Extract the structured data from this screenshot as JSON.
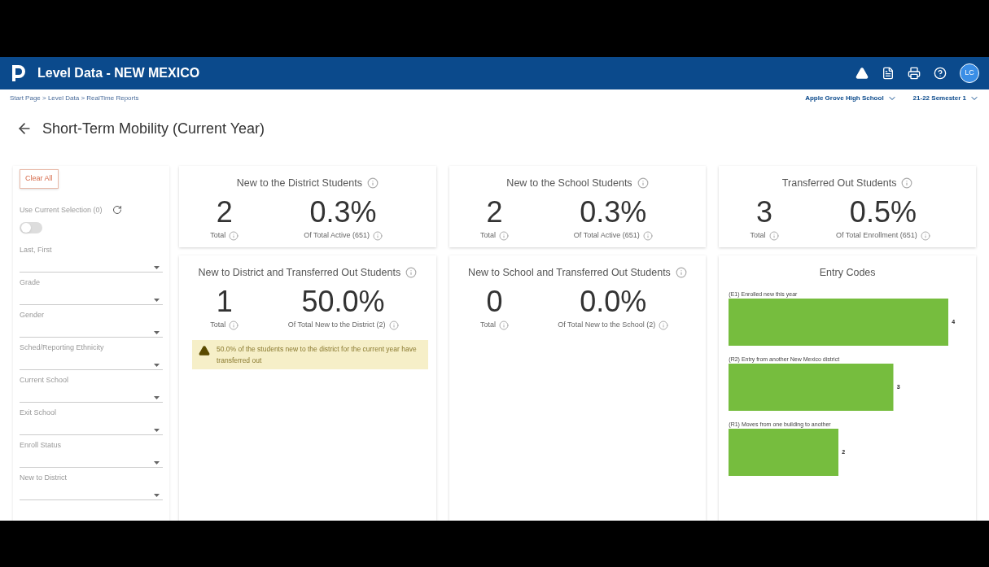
{
  "header": {
    "title": "Level Data - NEW MEXICO",
    "avatar": "LC"
  },
  "breadcrumb": "Start Page > Level Data > RealTime Reports",
  "school_selector": "Apple Grove High School",
  "term_selector": "21-22 Semester 1",
  "page_title": "Short-Term Mobility (Current Year)",
  "filters": {
    "clear_button": "Clear All",
    "use_current_selection": {
      "label": "Use Current Selection (0)",
      "on": false
    },
    "dropdowns": [
      "Last, First",
      "Grade",
      "Gender",
      "Sched/Reporting Ethnicity",
      "Current School",
      "Exit School",
      "Enroll Status",
      "New to District"
    ]
  },
  "cards": [
    {
      "title": "New to the District Students",
      "total": "2",
      "total_label": "Total",
      "percent": "0.3%",
      "percent_label": "Of Total Active (651)"
    },
    {
      "title": "New to the School Students",
      "total": "2",
      "total_label": "Total",
      "percent": "0.3%",
      "percent_label": "Of Total Active (651)"
    },
    {
      "title": "Transferred Out Students",
      "total": "3",
      "total_label": "Total",
      "percent": "0.5%",
      "percent_label": "Of Total Enrollment (651)"
    },
    {
      "title": "New to District and Transferred Out Students",
      "total": "1",
      "total_label": "Total",
      "percent": "50.0%",
      "percent_label": "Of Total New to the District (2)",
      "warning": "50.0% of the students new to the district for the current year have transferred out"
    },
    {
      "title": "New to School and Transferred Out Students",
      "total": "0",
      "total_label": "Total",
      "percent": "0.0%",
      "percent_label": "Of Total New to the School (2)"
    }
  ],
  "entry_codes": {
    "title": "Entry Codes",
    "chart_data": {
      "type": "bar",
      "orientation": "horizontal",
      "data_labels": true,
      "categories": [
        "(E1) Enrolled new this year",
        "(R2) Entry from another New Mexico district",
        "(R1) Moves from one building to another"
      ],
      "series": [
        {
          "color": "#76bd3e",
          "values": [
            4,
            3,
            2
          ]
        }
      ]
    }
  }
}
